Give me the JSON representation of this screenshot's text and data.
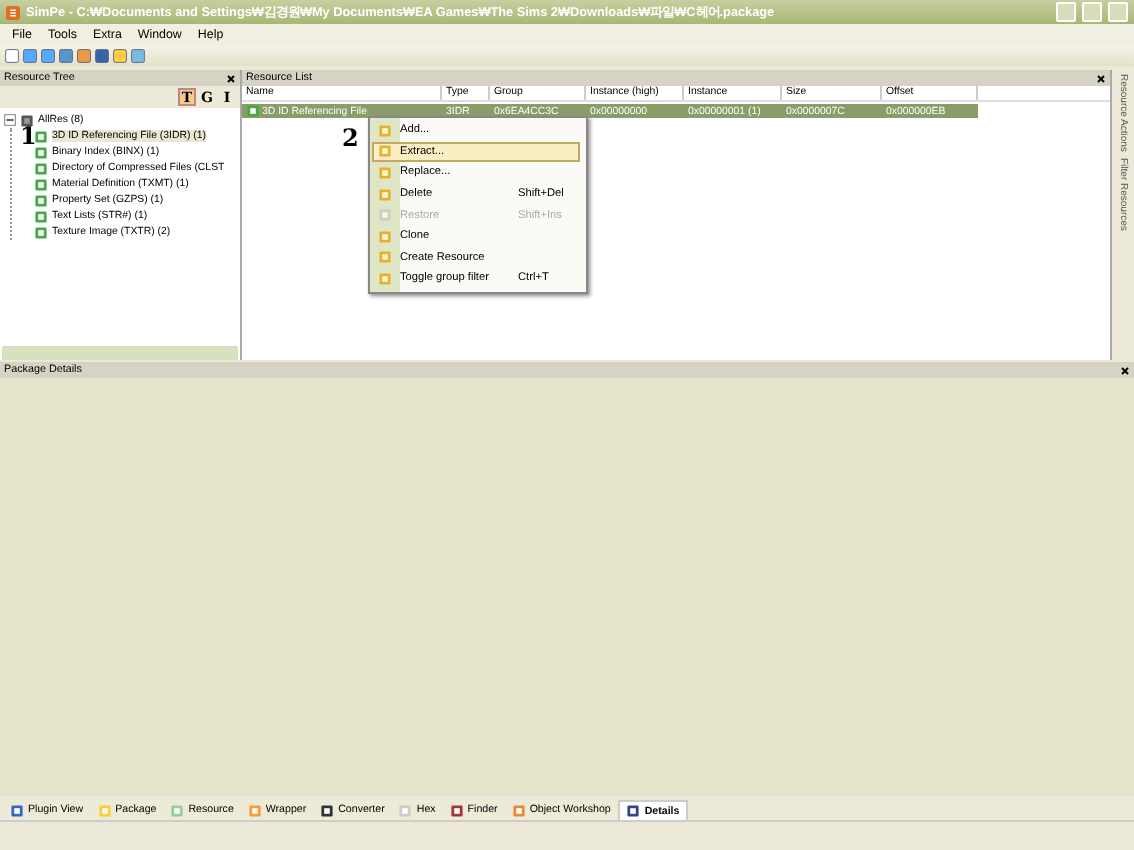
{
  "window": {
    "title": "SimPe - C:₩Documents and Settings₩김경원₩My Documents₩EA Games₩The Sims 2₩Downloads₩파일₩C헤어.package"
  },
  "menu": [
    "File",
    "Tools",
    "Extra",
    "Window",
    "Help"
  ],
  "resource_tree": {
    "title": "Resource Tree",
    "filters": [
      {
        "label": "T",
        "selected": true
      },
      {
        "label": "G",
        "selected": false
      },
      {
        "label": "I",
        "selected": false
      }
    ],
    "root": {
      "label": "AllRes (8)",
      "expanded": true,
      "children": [
        {
          "label": "3D ID Referencing File (3IDR) (1)",
          "selected": true
        },
        {
          "label": "Binary Index (BINX) (1)",
          "selected": false
        },
        {
          "label": "Directory of Compressed Files (CLST",
          "selected": false
        },
        {
          "label": "Material Definition (TXMT) (1)",
          "selected": false
        },
        {
          "label": "Property Set (GZPS) (1)",
          "selected": false
        },
        {
          "label": "Text Lists (STR#) (1)",
          "selected": false
        },
        {
          "label": "Texture Image (TXTR) (2)",
          "selected": false
        }
      ]
    }
  },
  "resource_list": {
    "title": "Resource List",
    "columns": [
      "Name",
      "Type",
      "Group",
      "Instance (high)",
      "Instance",
      "Size",
      "Offset"
    ],
    "rows": [
      {
        "selected": true,
        "cells": [
          "3D ID Referencing File",
          "3IDR",
          "0x6EA4CC3C",
          "0x00000000",
          "0x00000001 (1)",
          "0x0000007C",
          "0x000000EB"
        ]
      }
    ]
  },
  "context_menu": [
    {
      "label": "Add...",
      "selected": false,
      "disabled": false
    },
    {
      "label": "Extract...",
      "selected": true,
      "disabled": false
    },
    {
      "label": "Replace...",
      "selected": false,
      "disabled": false
    },
    {
      "label": "Delete",
      "shortcut": "Shift+Del",
      "selected": false,
      "disabled": false
    },
    {
      "label": "Restore",
      "shortcut": "Shift+Ins",
      "selected": false,
      "disabled": true
    },
    {
      "label": "Clone",
      "selected": false,
      "disabled": false
    },
    {
      "label": "Create Resource",
      "selected": false,
      "disabled": false
    },
    {
      "label": "Toggle group filter",
      "shortcut": "Ctrl+T",
      "selected": false,
      "disabled": false
    }
  ],
  "side_tabs": [
    "Resource Actions",
    "Filter Resources"
  ],
  "package_details": {
    "title": "Package Details"
  },
  "bottom_tabs": [
    {
      "label": "Plugin View",
      "selected": false
    },
    {
      "label": "Package",
      "selected": false
    },
    {
      "label": "Resource",
      "selected": false
    },
    {
      "label": "Wrapper",
      "selected": false
    },
    {
      "label": "Converter",
      "selected": false
    },
    {
      "label": "Hex",
      "selected": false
    },
    {
      "label": "Finder",
      "selected": false
    },
    {
      "label": "Object Workshop",
      "selected": false
    },
    {
      "label": "Details",
      "selected": true
    }
  ],
  "annotations": [
    "1",
    "2"
  ]
}
